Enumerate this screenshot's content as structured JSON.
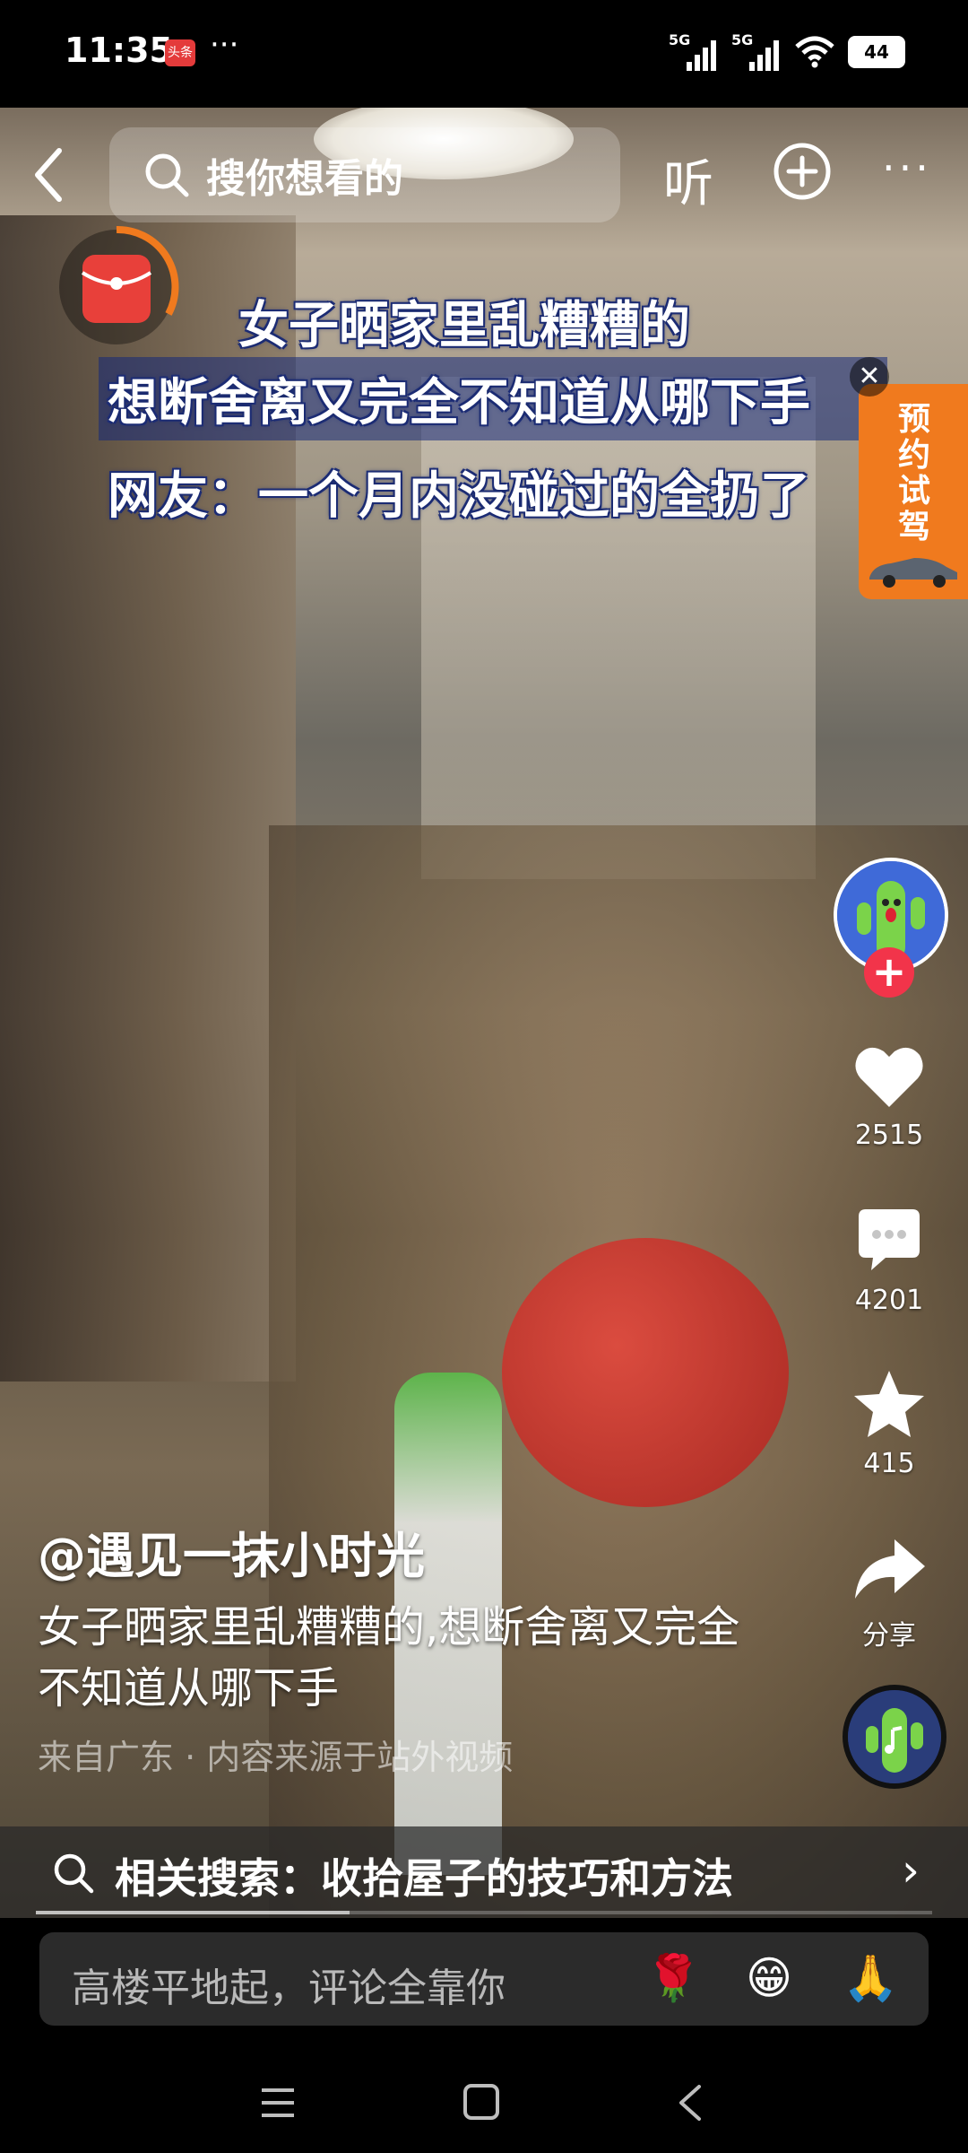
{
  "status_bar": {
    "time": "11:35",
    "news_badge": "头条",
    "overflow_dots": "···",
    "signal_1": "5G",
    "signal_2": "5G",
    "battery": "44"
  },
  "top_bar": {
    "search_placeholder": "搜你想看的",
    "listen_label": "听",
    "more_label": "···"
  },
  "video_overlay": {
    "line1": "女子晒家里乱糟糟的",
    "line2": "想断舍离又完全不知道从哪下手",
    "line3": "网友：一个月内没碰过的全扔了"
  },
  "ad": {
    "label": "预约试驾",
    "close": "✕"
  },
  "actions": {
    "follow": "+",
    "likes": "2515",
    "comments": "4201",
    "favorites": "415",
    "share": "分享"
  },
  "post": {
    "author": "@遇见一抹小时光",
    "description": "女子晒家里乱糟糟的,想断舍离又完全不知道从哪下手",
    "source": "来自广东 · 内容来源于站外视频"
  },
  "related_search": {
    "text": "相关搜索：收拾屋子的技巧和方法",
    "chevron": "›"
  },
  "playback": {
    "progress": 0.35
  },
  "comment_bar": {
    "placeholder": "高楼平地起，评论全靠你",
    "emoji_1": "🌹",
    "emoji_2": "😁",
    "emoji_3": "🙏"
  },
  "colors": {
    "ad_orange": "#f07a1e",
    "follow_red": "#f2344a",
    "accent_red": "#e43b3b"
  }
}
